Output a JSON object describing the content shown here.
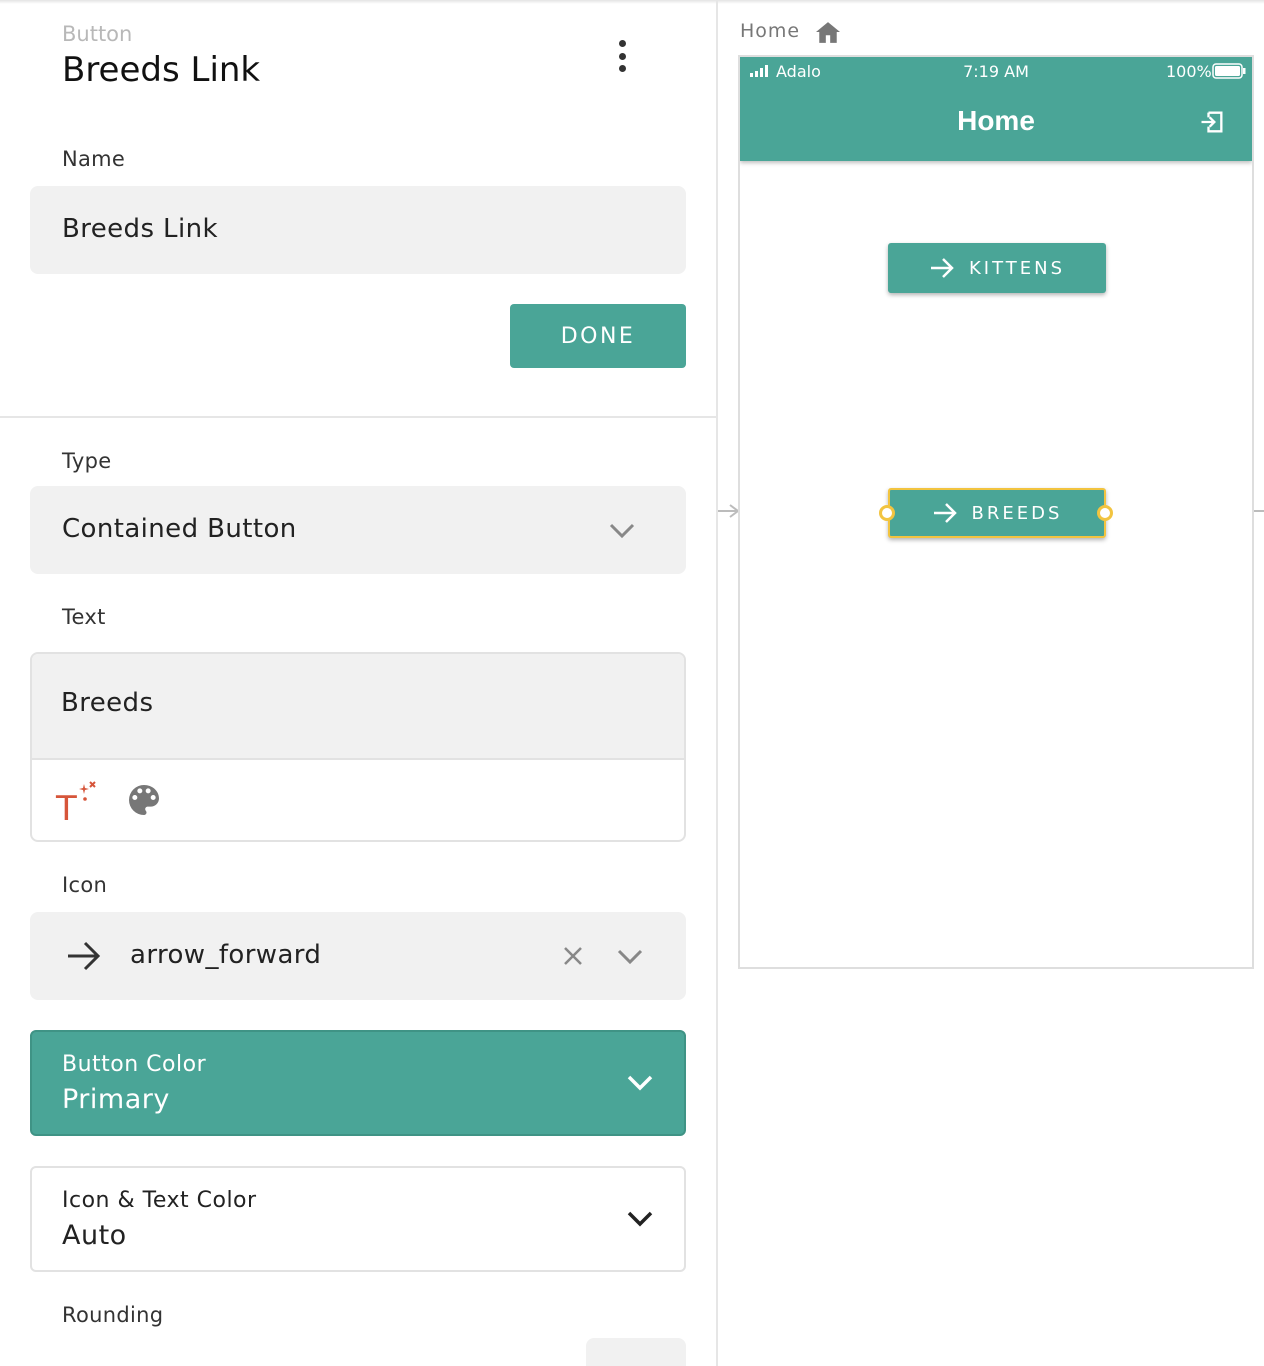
{
  "panel": {
    "kind": "Button",
    "title": "Breeds Link",
    "name_label": "Name",
    "name_value": "Breeds Link",
    "done_label": "DONE",
    "type_label": "Type",
    "type_value": "Contained Button",
    "text_label": "Text",
    "text_value": "Breeds",
    "icon_label": "Icon",
    "icon_value": "arrow_forward",
    "button_color_label": "Button Color",
    "button_color_value": "Primary",
    "icon_text_color_label": "Icon & Text Color",
    "icon_text_color_value": "Auto",
    "rounding_label": "Rounding"
  },
  "canvas": {
    "breadcrumb": "Home",
    "status_carrier": "Adalo",
    "status_time": "7:19 AM",
    "status_battery": "100%",
    "screen_title": "Home",
    "buttons": [
      {
        "label": "KITTENS"
      },
      {
        "label": "BREEDS"
      }
    ]
  },
  "colors": {
    "primary": "#4aa597",
    "selection": "#f2c440",
    "magic_text": "#d6553a"
  },
  "icons": [
    "more-vertical-icon",
    "chevron-down-icon",
    "magic-text-icon",
    "palette-icon",
    "arrow-forward-icon",
    "close-icon",
    "home-icon",
    "signal-icon",
    "battery-icon",
    "logout-icon"
  ]
}
